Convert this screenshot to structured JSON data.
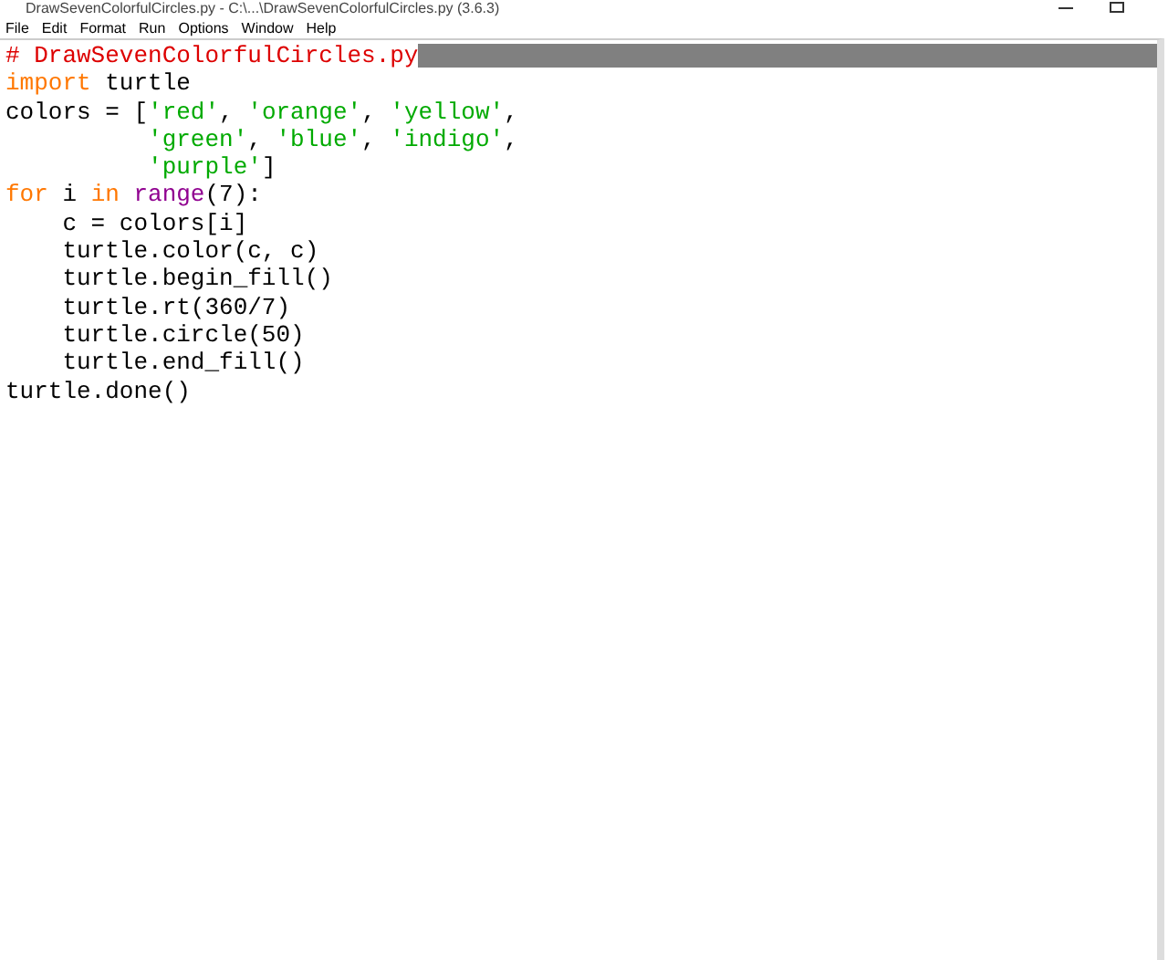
{
  "window": {
    "title": "DrawSevenColorfulCircles.py - C:\\...\\DrawSevenColorfulCircles.py (3.6.3)"
  },
  "menu": [
    "File",
    "Edit",
    "Format",
    "Run",
    "Options",
    "Window",
    "Help"
  ],
  "code": [
    [
      {
        "kind": "comment",
        "text": "# DrawSevenColorfulCircles.py"
      }
    ],
    [
      {
        "kind": "keyword",
        "text": "import"
      },
      {
        "kind": "plain",
        "text": " turtle"
      }
    ],
    [
      {
        "kind": "plain",
        "text": "colors = ["
      },
      {
        "kind": "string",
        "text": "'red'"
      },
      {
        "kind": "plain",
        "text": ", "
      },
      {
        "kind": "string",
        "text": "'orange'"
      },
      {
        "kind": "plain",
        "text": ", "
      },
      {
        "kind": "string",
        "text": "'yellow'"
      },
      {
        "kind": "plain",
        "text": ","
      }
    ],
    [
      {
        "kind": "string",
        "text": "          'green'"
      },
      {
        "kind": "plain",
        "text": ", "
      },
      {
        "kind": "string",
        "text": "'blue'"
      },
      {
        "kind": "plain",
        "text": ", "
      },
      {
        "kind": "string",
        "text": "'indigo'"
      },
      {
        "kind": "plain",
        "text": ","
      }
    ],
    [
      {
        "kind": "string",
        "text": "          'purple'"
      },
      {
        "kind": "plain",
        "text": "]"
      }
    ],
    [
      {
        "kind": "keyword",
        "text": "for"
      },
      {
        "kind": "plain",
        "text": " i "
      },
      {
        "kind": "keyword",
        "text": "in "
      },
      {
        "kind": "builtin",
        "text": "range"
      },
      {
        "kind": "plain",
        "text": "(7):"
      }
    ],
    [
      {
        "kind": "plain",
        "text": "    c = colors[i]"
      }
    ],
    [
      {
        "kind": "plain",
        "text": "    turtle.color(c, c)"
      }
    ],
    [
      {
        "kind": "plain",
        "text": "    turtle.begin_fill()"
      }
    ],
    [
      {
        "kind": "plain",
        "text": "    turtle.rt(360/7)"
      }
    ],
    [
      {
        "kind": "plain",
        "text": "    turtle.circle(50)"
      }
    ],
    [
      {
        "kind": "plain",
        "text": "    turtle.end_fill()"
      }
    ],
    [
      {
        "kind": "plain",
        "text": "turtle.done()"
      }
    ]
  ]
}
